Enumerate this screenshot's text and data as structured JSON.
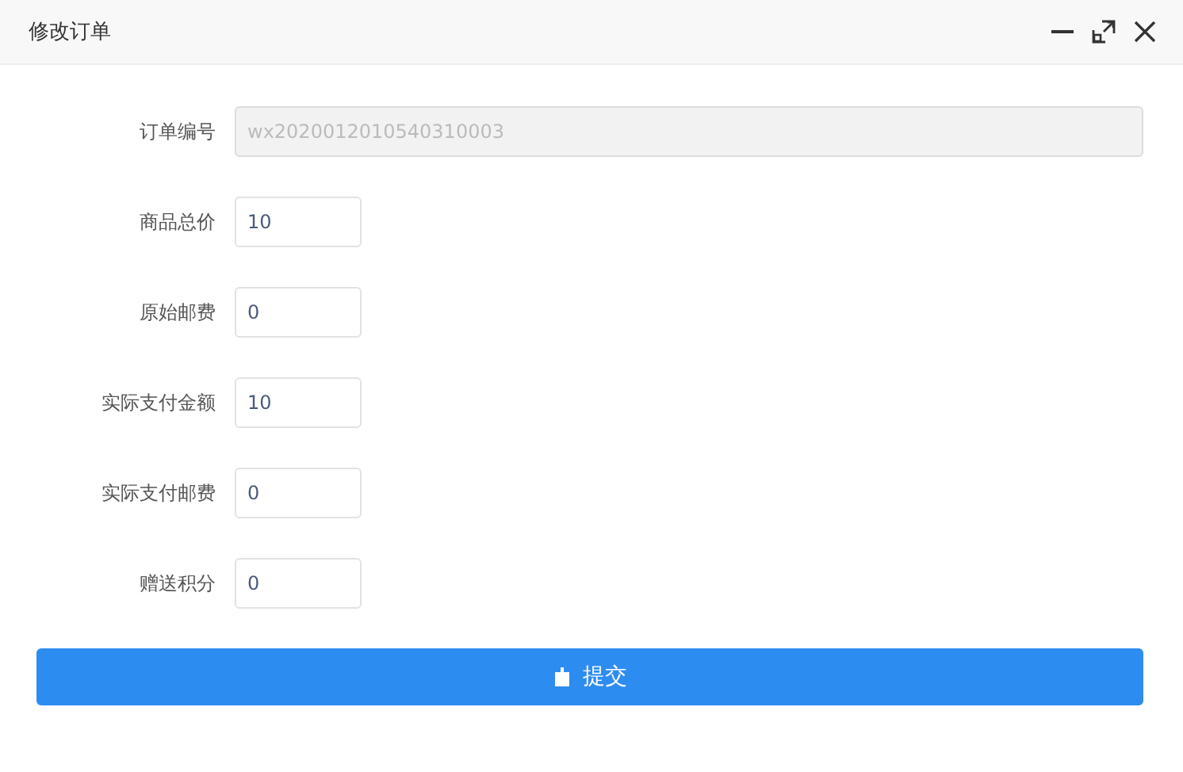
{
  "window": {
    "title": "修改订单"
  },
  "fields": [
    {
      "label": "订单编号",
      "value": "wx2020012010540310003",
      "kind": "wide",
      "disabled": true
    },
    {
      "label": "商品总价",
      "value": "10",
      "kind": "short",
      "disabled": false
    },
    {
      "label": "原始邮费",
      "value": "0",
      "kind": "short",
      "disabled": false
    },
    {
      "label": "实际支付金额",
      "value": "10",
      "kind": "short",
      "disabled": false
    },
    {
      "label": "实际支付邮费",
      "value": "0",
      "kind": "short",
      "disabled": false
    },
    {
      "label": "赠送积分",
      "value": "0",
      "kind": "short",
      "disabled": false
    }
  ],
  "submit": {
    "label": "提交"
  }
}
